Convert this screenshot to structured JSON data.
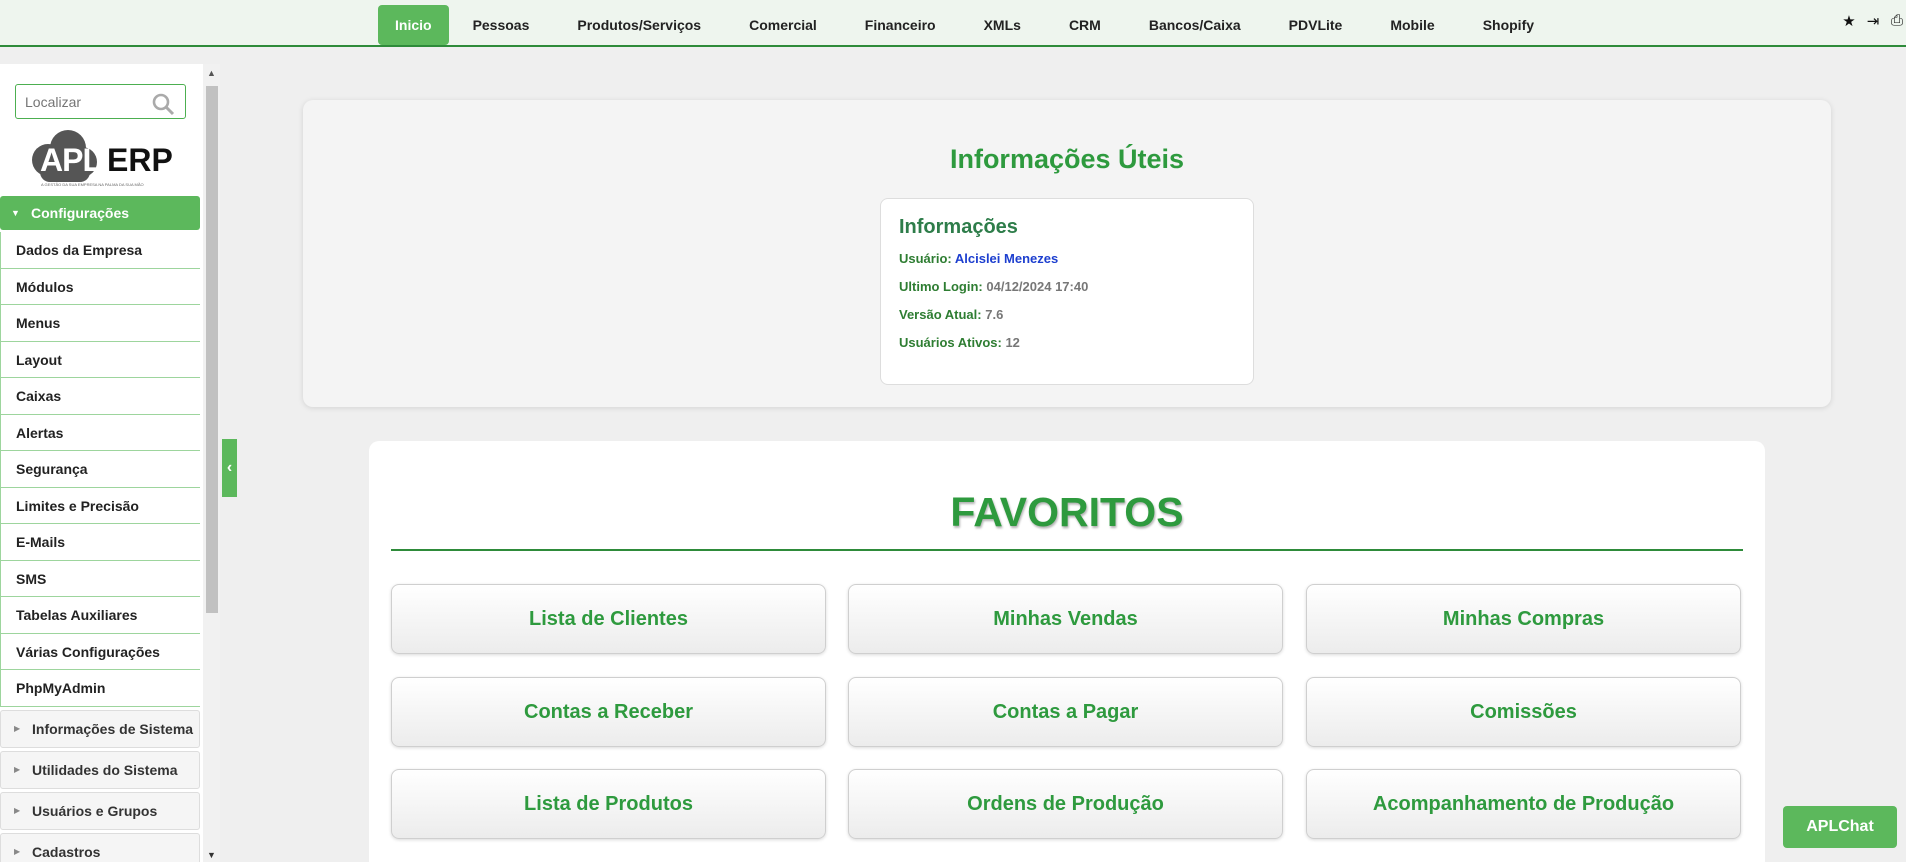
{
  "topnav": {
    "items": [
      "Inicio",
      "Pessoas",
      "Produtos/Serviços",
      "Comercial",
      "Financeiro",
      "XMLs",
      "CRM",
      "Bancos/Caixa",
      "PDVLite",
      "Mobile",
      "Shopify"
    ],
    "active": "Inicio",
    "icons": [
      "star-icon",
      "logout-icon",
      "print-icon"
    ]
  },
  "sidebar": {
    "search_placeholder": "Localizar",
    "logo": {
      "apl": "APL",
      "erp": "ERP",
      "tagline": "A GESTÃO DA SUA EMPRESA NA PALMA DA SUA MÃO"
    },
    "expanded_section": "Configurações",
    "sub_items": [
      "Dados da Empresa",
      "Módulos",
      "Menus",
      "Layout",
      "Caixas",
      "Alertas",
      "Segurança",
      "Limites e Precisão",
      "E-Mails",
      "SMS",
      "Tabelas Auxiliares",
      "Várias Configurações",
      "PhpMyAdmin"
    ],
    "collapsed_sections": [
      "Informações de Sistema",
      "Utilidades do Sistema",
      "Usuários e Grupos",
      "Cadastros"
    ]
  },
  "info": {
    "title": "Informações Úteis",
    "card_title": "Informações",
    "usuario_label": "Usuário:",
    "usuario_value": "Alcislei Menezes",
    "login_label": "Ultimo Login:",
    "login_value": "04/12/2024 17:40",
    "versao_label": "Versão Atual:",
    "versao_value": "7.6",
    "ativos_label": "Usuários Ativos:",
    "ativos_value": "12"
  },
  "favorites": {
    "title": "FAVORITOS",
    "items": [
      "Lista de Clientes",
      "Minhas Vendas",
      "Minhas Compras",
      "Contas a Receber",
      "Contas a Pagar",
      "Comissões",
      "Lista de Produtos",
      "Ordens de Produção",
      "Acompanhamento de Produção"
    ]
  },
  "chat_label": "APLChat",
  "colors": {
    "primary_green": "#5cb85c",
    "title_green": "#2e9a3e",
    "nav_border": "#2e8b3a"
  }
}
